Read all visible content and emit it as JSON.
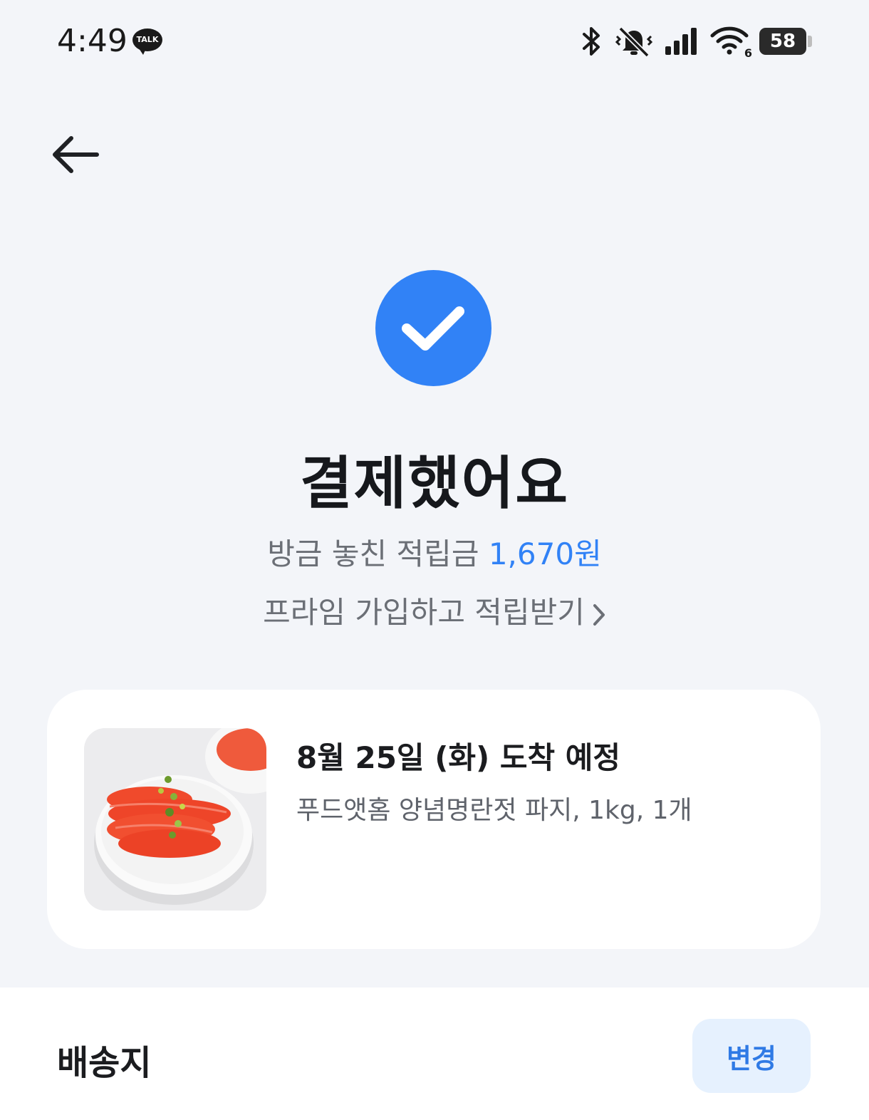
{
  "status_bar": {
    "time": "4:49",
    "talk_badge": "TALK",
    "battery": "58",
    "wifi_band": "6",
    "icons": [
      "bluetooth-icon",
      "bell-off-icon",
      "signal-icon",
      "wifi-icon",
      "battery-icon"
    ]
  },
  "header": {
    "back_icon": "arrow-left-icon"
  },
  "result": {
    "check_icon": "check-icon",
    "check_color": "#3182f6",
    "title": "결제했어요",
    "missed_points_label": "방금 놓친 적립금",
    "missed_points_amount": "1,670원",
    "prime_link": "프라임 가입하고 적립받기"
  },
  "order": {
    "arrival": "8월 25일 (화) 도착 예정",
    "product": "푸드앳홈 양념명란젓 파지, 1kg, 1개"
  },
  "address": {
    "label": "배송지",
    "change_button": "변경"
  },
  "colors": {
    "accent": "#3182f6",
    "background": "#f3f5f9",
    "card": "#ffffff"
  }
}
